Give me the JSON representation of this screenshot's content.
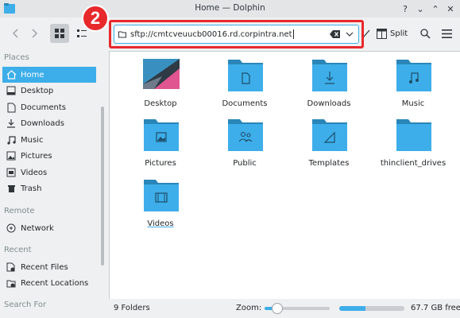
{
  "window": {
    "title": "Home — Dolphin",
    "buttons": [
      "?",
      "⌄",
      "⌃",
      "✕"
    ]
  },
  "annotation": {
    "badge_number": "2"
  },
  "toolbar": {
    "url": "sftp://cmtcveuucb00016.rd.corpintra.net",
    "split_label": "Split"
  },
  "sidebar": {
    "sections": {
      "places": "Places",
      "remote": "Remote",
      "recent": "Recent",
      "search": "Search For"
    },
    "places": [
      {
        "label": "Home",
        "icon": "home-icon",
        "active": true
      },
      {
        "label": "Desktop",
        "icon": "desktop-icon"
      },
      {
        "label": "Documents",
        "icon": "documents-icon"
      },
      {
        "label": "Downloads",
        "icon": "downloads-icon"
      },
      {
        "label": "Music",
        "icon": "music-icon"
      },
      {
        "label": "Pictures",
        "icon": "pictures-icon"
      },
      {
        "label": "Videos",
        "icon": "videos-icon"
      },
      {
        "label": "Trash",
        "icon": "trash-icon"
      }
    ],
    "remote": [
      {
        "label": "Network",
        "icon": "network-icon"
      }
    ],
    "recent": [
      {
        "label": "Recent Files",
        "icon": "recent-files-icon"
      },
      {
        "label": "Recent Locations",
        "icon": "recent-locations-icon"
      }
    ]
  },
  "folders": [
    {
      "label": "Desktop",
      "icon": "desktop-wallpaper-icon"
    },
    {
      "label": "Documents",
      "icon": "folder-documents-icon"
    },
    {
      "label": "Downloads",
      "icon": "folder-downloads-icon"
    },
    {
      "label": "Music",
      "icon": "folder-music-icon"
    },
    {
      "label": "Pictures",
      "icon": "folder-pictures-icon"
    },
    {
      "label": "Public",
      "icon": "folder-public-icon"
    },
    {
      "label": "Templates",
      "icon": "folder-templates-icon"
    },
    {
      "label": "thinclient_drives",
      "icon": "folder-icon"
    },
    {
      "label": "Videos",
      "icon": "folder-videos-icon"
    }
  ],
  "status": {
    "folders_count": "9 Folders",
    "zoom_label": "Zoom:",
    "zoom_level": 0.2,
    "disk_used_fraction": 0.4,
    "free_space": "67.7 GB free"
  },
  "colors": {
    "accent": "#3daee9",
    "folder": "#3daee9",
    "folder_tab": "#2a86b8",
    "highlight": "#e8292c"
  }
}
